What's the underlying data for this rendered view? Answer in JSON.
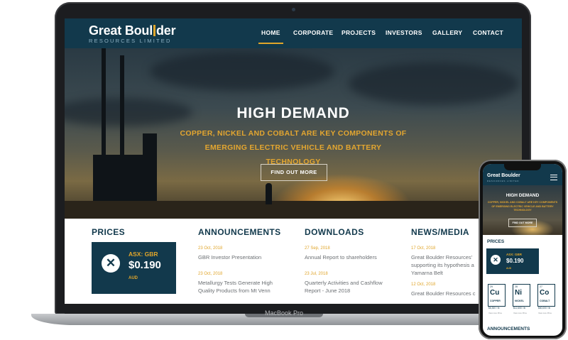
{
  "laptop": {
    "brand": "MacBook Pro"
  },
  "site": {
    "logo": {
      "name_part1": "Great Boul",
      "name_part2": "der",
      "subtitle": "RESOURCES LIMITED"
    },
    "nav": [
      {
        "label": "HOME",
        "active": true
      },
      {
        "label": "CORPORATE"
      },
      {
        "label": "PROJECTS"
      },
      {
        "label": "INVESTORS"
      },
      {
        "label": "GALLERY"
      },
      {
        "label": "CONTACT"
      }
    ],
    "hero": {
      "title": "HIGH DEMAND",
      "subtitle": "COPPER, NICKEL AND COBALT ARE KEY COMPONENTS OF EMERGING ELECTRIC VEHICLE AND BATTERY TECHNOLOGY",
      "button": "FIND OUT MORE"
    },
    "prices": {
      "heading": "PRICES",
      "icon_glyph": "✕",
      "code": "ASX: GBR",
      "price": "$0.190",
      "currency": "AUD"
    },
    "announcements": {
      "heading": "ANNOUNCEMENTS",
      "items": [
        {
          "date": "23 Oct, 2018",
          "title": "GBR Investor Presentation"
        },
        {
          "date": "23 Oct, 2018",
          "title_line1": "Metallurgy Tests Generate High",
          "title_line2": "Quality Products from Mt Venn"
        }
      ]
    },
    "downloads": {
      "heading": "DOWNLOADS",
      "items": [
        {
          "date": "27 Sep, 2018",
          "title": "Annual Report to shareholders"
        },
        {
          "date": "23 Jul, 2018",
          "title_line1": "Quarterly Activities and Cashflow",
          "title_line2": "Report - June 2018"
        }
      ]
    },
    "news": {
      "heading": "NEWS/MEDIA",
      "items": [
        {
          "date": "17 Oct, 2018",
          "title_line1": "Great Boulder Resources'",
          "title_line2": "supporting its hypothesis a",
          "title_line3": "Yamarna Belt"
        },
        {
          "date": "12 Oct, 2018",
          "title": "Great Boulder Resources c"
        }
      ]
    }
  },
  "phone": {
    "logo": "Great Boulder",
    "logo_sub": "RESOURCES LIMITED",
    "hero_title": "HIGH DEMAND",
    "hero_subtitle": "COPPER, NICKEL AND COBALT ARE KEY COMPONENTS OF EMERGING ELECTRIC VEHICLE AND BATTERY TECHNOLOGY",
    "hero_button": "FIND OUT MORE",
    "prices_heading": "PRICES",
    "code": "ASX: GBR",
    "price": "$0.190",
    "currency": "AUD",
    "metals": [
      {
        "number": "29",
        "symbol": "Cu",
        "name": "COPPER",
        "price": "$6,300 / lb",
        "note": "View Live Price"
      },
      {
        "number": "28",
        "symbol": "Ni",
        "name": "NICKEL",
        "price": "$12,650 / lb",
        "note": "View Live Price"
      },
      {
        "number": "27",
        "symbol": "Co",
        "name": "COBALT",
        "price": "$60,000 / lb",
        "note": "View Live Price"
      }
    ],
    "announcements_heading": "ANNOUNCEMENTS"
  },
  "colors": {
    "navy": "#12394c",
    "accent": "#e0a52a"
  }
}
